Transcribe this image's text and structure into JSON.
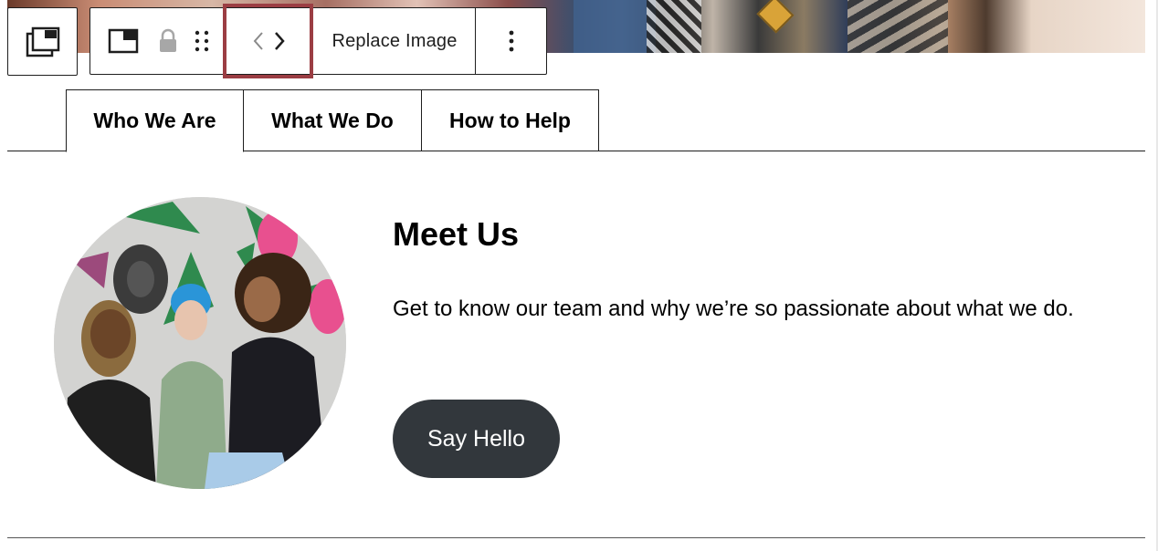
{
  "toolbar": {
    "parent_icon": "parent-block-icon",
    "block_icon": "image-block-icon",
    "lock_icon": "lock-icon",
    "drag_icon": "drag-handle-icon",
    "move_icons": [
      "chevron-left-icon",
      "chevron-right-icon"
    ],
    "replace_label": "Replace Image",
    "more_icon": "more-options-icon"
  },
  "tabs": [
    {
      "label": "Who We Are",
      "active": true
    },
    {
      "label": "What We Do",
      "active": false
    },
    {
      "label": "How to Help",
      "active": false
    }
  ],
  "content": {
    "heading": "Meet Us",
    "body": "Get to know our team and why we’re so passionate about what we do.",
    "button_label": "Say Hello"
  },
  "colors": {
    "button_bg": "#32373c",
    "highlight": "#9b3d43"
  }
}
